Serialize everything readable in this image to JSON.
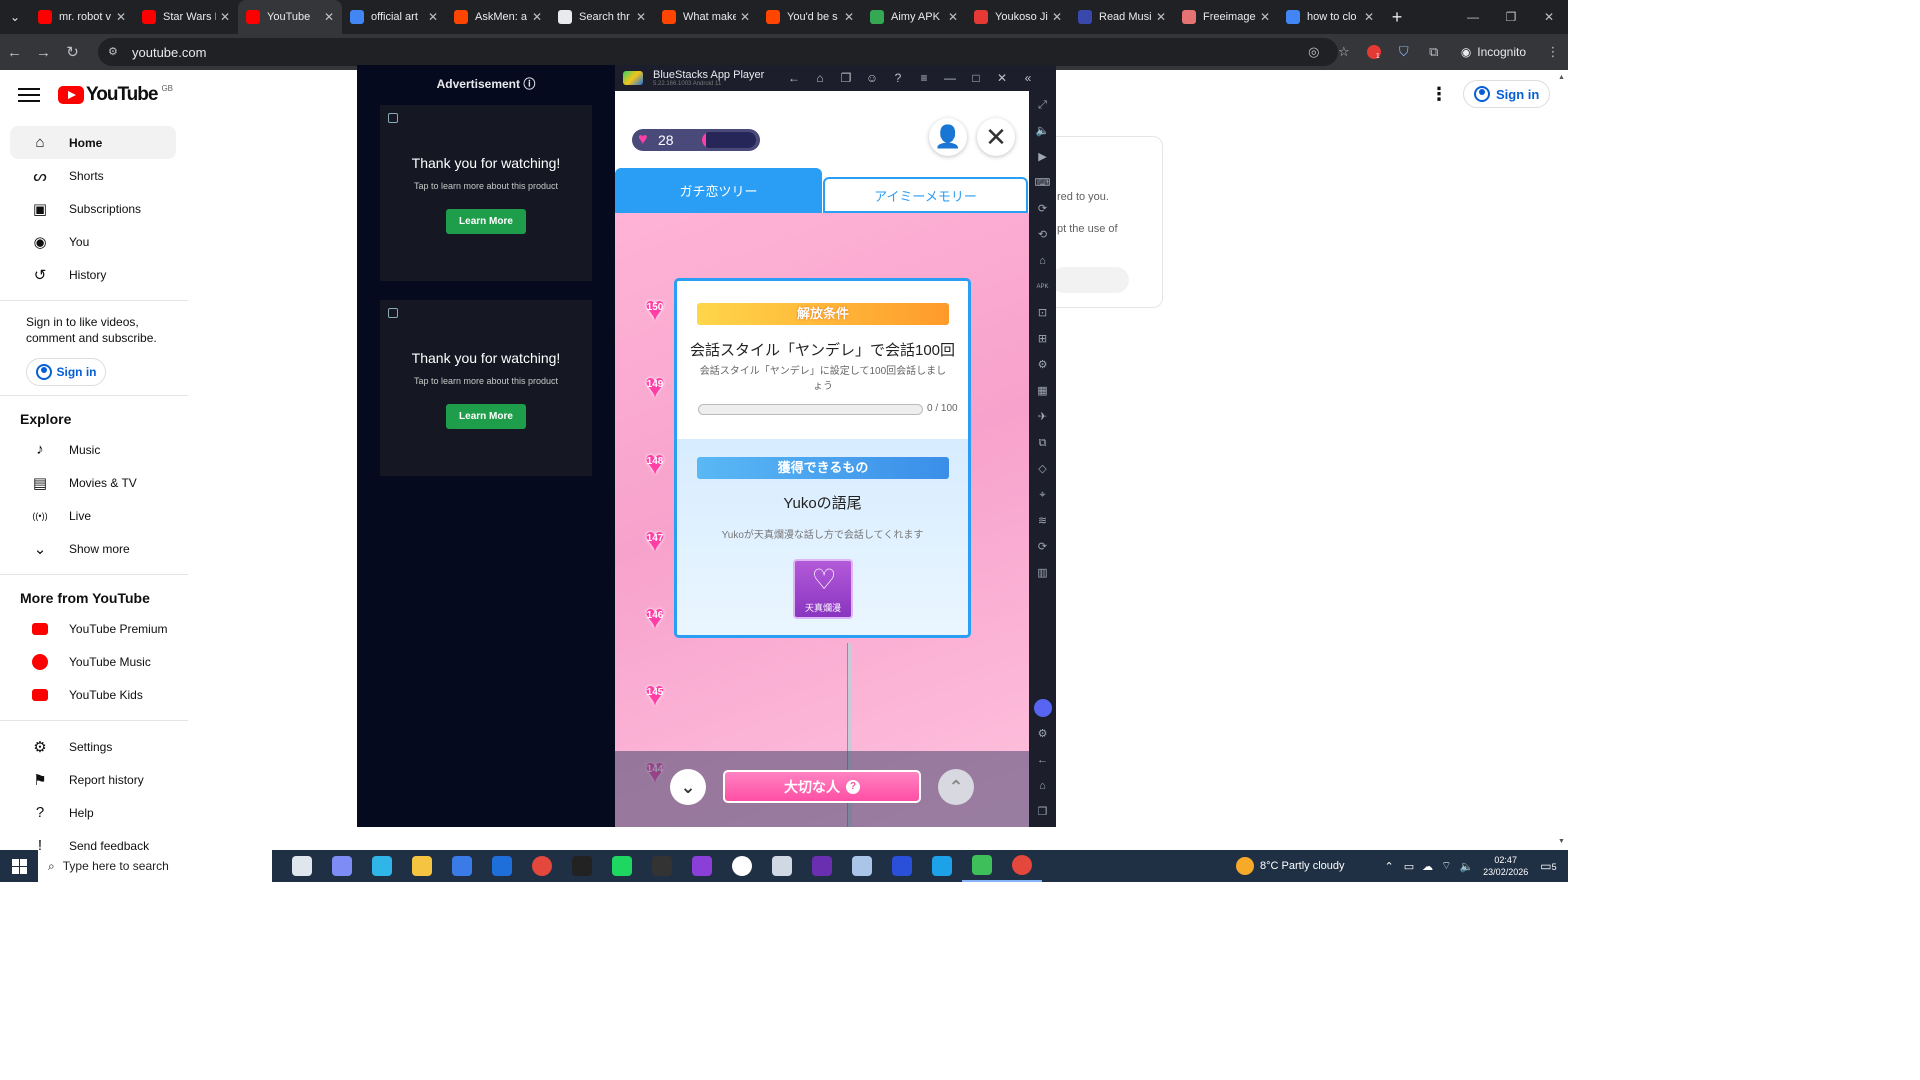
{
  "browser": {
    "tabs": [
      {
        "title": "mr. robot v",
        "favicon_color": "#ff0000",
        "icon": "youtube-icon"
      },
      {
        "title": "Star Wars I",
        "favicon_color": "#ff0000",
        "icon": "youtube-icon"
      },
      {
        "title": "YouTube",
        "favicon_color": "#ff0000",
        "icon": "youtube-icon",
        "active": true
      },
      {
        "title": "official art",
        "favicon_color": "#4285f4",
        "icon": "google-icon"
      },
      {
        "title": "AskMen: a",
        "favicon_color": "#ff4500",
        "icon": "reddit-icon"
      },
      {
        "title": "Search thr",
        "favicon_color": "#e8eaed",
        "icon": "perplexity-icon"
      },
      {
        "title": "What make",
        "favicon_color": "#ff4500",
        "icon": "reddit-icon"
      },
      {
        "title": "You'd be s",
        "favicon_color": "#ff4500",
        "icon": "reddit-icon"
      },
      {
        "title": "Aimy APK",
        "favicon_color": "#34a853",
        "icon": "apk-icon"
      },
      {
        "title": "Youkoso Ji",
        "favicon_color": "#e53935",
        "icon": "site-icon"
      },
      {
        "title": "Read Musi",
        "favicon_color": "#3949ab",
        "icon": "site-icon"
      },
      {
        "title": "Freeimage",
        "favicon_color": "#e57373",
        "icon": "site-icon"
      },
      {
        "title": "how to clo",
        "favicon_color": "#4285f4",
        "icon": "google-icon"
      }
    ],
    "address": "youtube.com",
    "incognito_label": "Incognito",
    "extension_badge": "1"
  },
  "youtube": {
    "region": "GB",
    "logo_text": "YouTube",
    "sign_in": "Sign in",
    "sidebar_main": [
      {
        "label": "Home",
        "icon": "home-icon",
        "glyph": "⌂",
        "active": true
      },
      {
        "label": "Shorts",
        "icon": "shorts-icon",
        "glyph": "ᔕ"
      },
      {
        "label": "Subscriptions",
        "icon": "subscriptions-icon",
        "glyph": "▣"
      },
      {
        "label": "You",
        "icon": "you-icon",
        "glyph": "◉"
      },
      {
        "label": "History",
        "icon": "history-icon",
        "glyph": "↺"
      }
    ],
    "signin_prompt": "Sign in to like videos, comment and subscribe.",
    "explore_heading": "Explore",
    "explore": [
      {
        "label": "Music",
        "icon": "music-icon",
        "glyph": "♪"
      },
      {
        "label": "Movies & TV",
        "icon": "movies-icon",
        "glyph": "▤"
      },
      {
        "label": "Live",
        "icon": "live-icon",
        "glyph": "((•))"
      },
      {
        "label": "Show more",
        "icon": "chevron-down-icon",
        "glyph": "⌄"
      }
    ],
    "more_heading": "More from YouTube",
    "more": [
      {
        "label": "YouTube Premium",
        "icon": "youtube-premium-icon"
      },
      {
        "label": "YouTube Music",
        "icon": "youtube-music-icon"
      },
      {
        "label": "YouTube Kids",
        "icon": "youtube-kids-icon"
      }
    ],
    "footer": [
      {
        "label": "Settings",
        "icon": "gear-icon",
        "glyph": "⚙"
      },
      {
        "label": "Report history",
        "icon": "flag-icon",
        "glyph": "⚑"
      },
      {
        "label": "Help",
        "icon": "help-icon",
        "glyph": "?"
      },
      {
        "label": "Send feedback",
        "icon": "feedback-icon",
        "glyph": "!"
      }
    ],
    "card_text_1": "red to you.",
    "card_text_2": "pt the use of"
  },
  "ad": {
    "heading": "Advertisement ⓘ",
    "boxes": [
      {
        "title": "Thank you for watching!",
        "subtitle": "Tap to learn more about this product",
        "button": "Learn More"
      },
      {
        "title": "Thank you for watching!",
        "subtitle": "Tap to learn more about this product",
        "button": "Learn More"
      }
    ]
  },
  "bluestacks": {
    "title": "BlueStacks App Player",
    "version": "5.22.166.1003 Android 11",
    "controls": [
      "←",
      "⌂",
      "❐",
      "☺",
      "?",
      "≡",
      "—",
      "□",
      "✕",
      "«"
    ],
    "rail": [
      "⤢",
      "🔈",
      "▶",
      "⌨",
      "⟳",
      "⟲",
      "⌂",
      "APK",
      "⊡",
      "⊞",
      "⚙",
      "▦",
      "✈",
      "⧉",
      "◇",
      "⌖",
      "≋",
      "⟳",
      "▥"
    ],
    "rail_bottom": [
      "⚙",
      "←",
      "⌂",
      "❐"
    ]
  },
  "game": {
    "hearts": "28",
    "heart_gauge_fraction": 0.08,
    "tab_active": "ガチ恋ツリー",
    "tab_inactive": "アイミーメモリー",
    "levels": [
      "150",
      "149",
      "148",
      "147",
      "146",
      "145",
      "144"
    ],
    "condition_ribbon": "解放条件",
    "condition_title": "会話スタイル「ヤンデレ」で会話100回",
    "condition_desc": "会話スタイル「ヤンデレ」に設定して100回会話しましょう",
    "progress_current": 0,
    "progress_total": 100,
    "progress_text": "0 / 100",
    "reward_ribbon": "獲得できるもの",
    "reward_title": "Yukoの語尾",
    "reward_desc": "Yukoが天真爛漫な話し方で会話してくれます",
    "reward_label": "天真爛漫",
    "bottom_button": "大切な人"
  },
  "taskbar": {
    "search_placeholder": "Type here to search",
    "apps": [
      {
        "icon": "task-view-icon",
        "color": "#dfe6ee"
      },
      {
        "icon": "copilot-icon",
        "color": "#7e8cf5"
      },
      {
        "icon": "edge-icon",
        "color": "#2fb5e8"
      },
      {
        "icon": "file-explorer-icon",
        "color": "#f5c542"
      },
      {
        "icon": "store-icon",
        "color": "#3b7be8"
      },
      {
        "icon": "outlook-icon",
        "color": "#1e6fd9"
      },
      {
        "icon": "chrome-icon",
        "color": "#e4473c"
      },
      {
        "icon": "live-app-icon",
        "color": "#222222"
      },
      {
        "icon": "spotify-icon",
        "color": "#1ed760"
      },
      {
        "icon": "app-dark-icon",
        "color": "#333333"
      },
      {
        "icon": "app-purple-icon",
        "color": "#8b3fd9"
      },
      {
        "icon": "chrome-alt-icon",
        "color": "#ffffff"
      },
      {
        "icon": "app-pen-icon",
        "color": "#cfd8e3"
      },
      {
        "icon": "app-violet-icon",
        "color": "#6a2fb0"
      },
      {
        "icon": "app-light-icon",
        "color": "#a9c6e8"
      },
      {
        "icon": "app-blue-icon",
        "color": "#2a4fd8"
      },
      {
        "icon": "app-cyan-icon",
        "color": "#1da1e8"
      },
      {
        "icon": "bluestacks-icon",
        "color": "#3fbf5a"
      },
      {
        "icon": "chrome-active-icon",
        "color": "#e4473c"
      }
    ],
    "weather": "8°C  Partly cloudy",
    "time": "02:47",
    "date": "23/02/2026",
    "notifications": "5"
  }
}
